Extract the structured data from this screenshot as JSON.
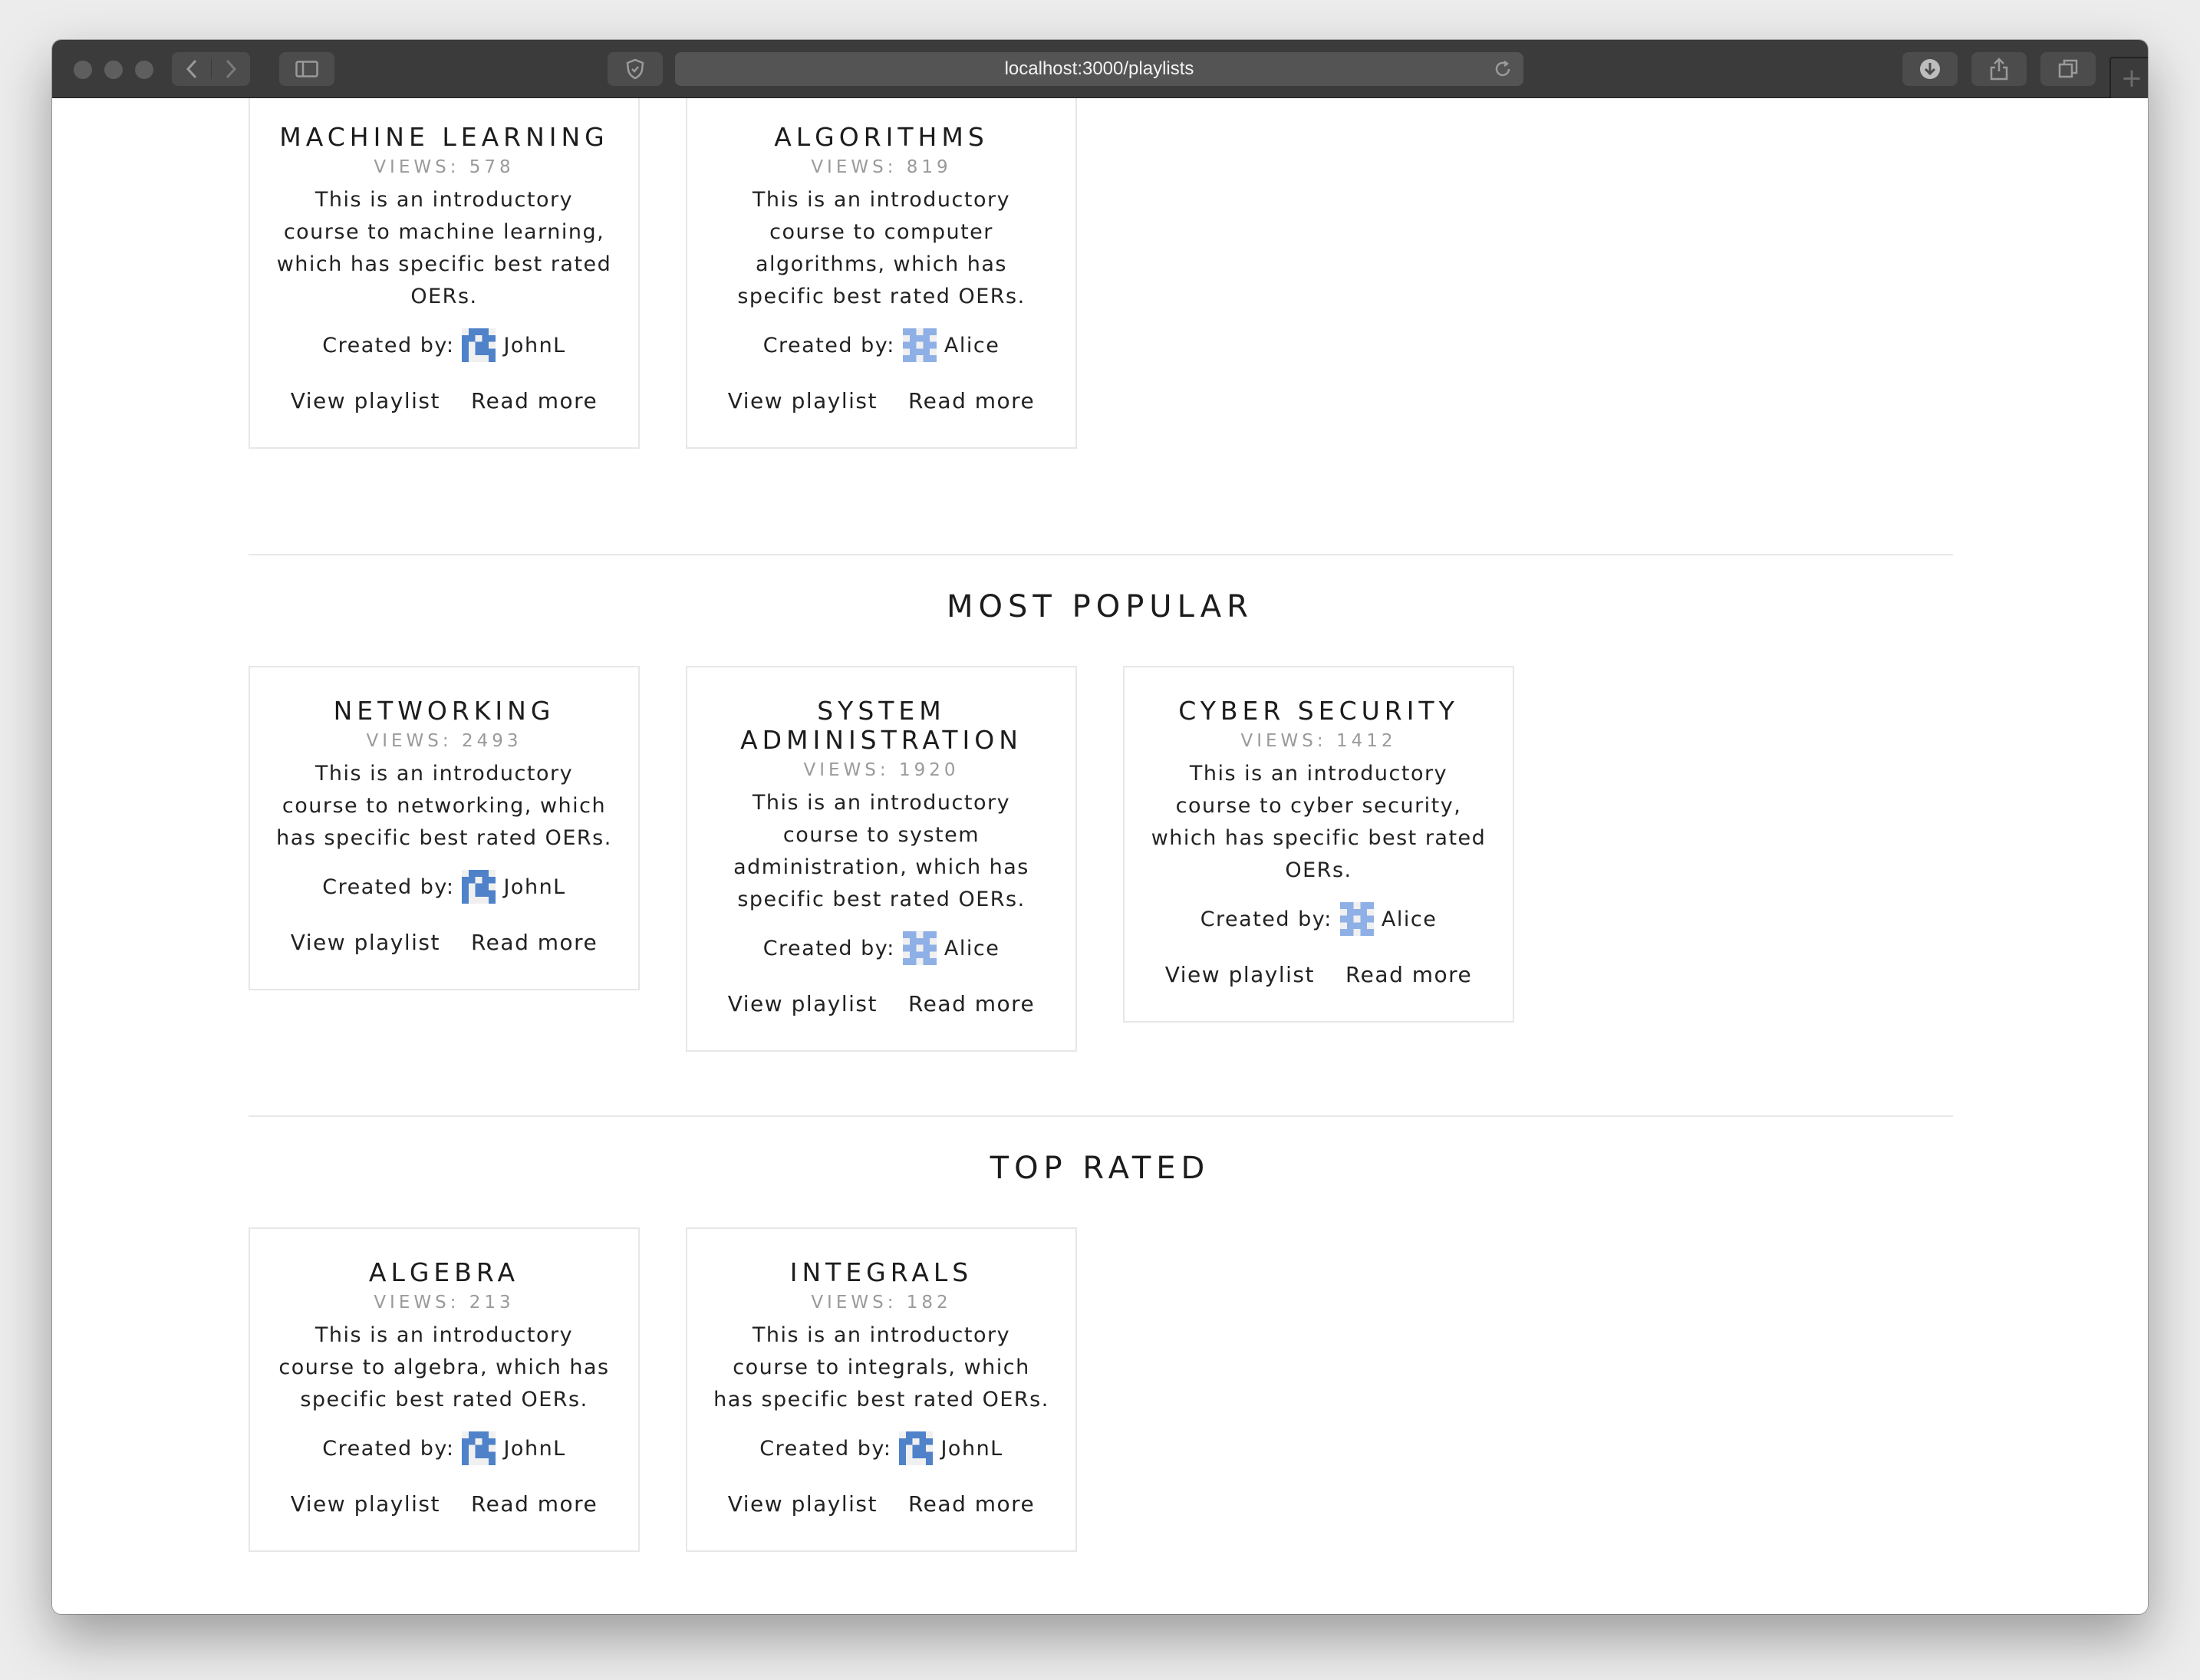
{
  "browser": {
    "url": "localhost:3000/playlists"
  },
  "sections": [
    {
      "title": "",
      "cards": [
        {
          "title": "MACHINE LEARNING",
          "views": "VIEWS: 578",
          "description": "This is an introductory course to machine learning, which has specific best rated OERs.",
          "created_by_label": "Created by:",
          "author": "JohnL",
          "view_label": "View playlist",
          "read_label": "Read more"
        },
        {
          "title": "ALGORITHMS",
          "views": "VIEWS: 819",
          "description": "This is an introductory course to computer algorithms, which has specific best rated OERs.",
          "created_by_label": "Created by:",
          "author": "Alice",
          "view_label": "View playlist",
          "read_label": "Read more"
        }
      ]
    },
    {
      "title": "MOST POPULAR",
      "cards": [
        {
          "title": "NETWORKING",
          "views": "VIEWS: 2493",
          "description": "This is an introductory course to networking, which has specific best rated OERs.",
          "created_by_label": "Created by:",
          "author": "JohnL",
          "view_label": "View playlist",
          "read_label": "Read more"
        },
        {
          "title": "SYSTEM ADMINISTRATION",
          "views": "VIEWS: 1920",
          "description": "This is an introductory course to system administration, which has specific best rated OERs.",
          "created_by_label": "Created by:",
          "author": "Alice",
          "view_label": "View playlist",
          "read_label": "Read more"
        },
        {
          "title": "CYBER SECURITY",
          "views": "VIEWS: 1412",
          "description": "This is an introductory course to cyber security, which has specific best rated OERs.",
          "created_by_label": "Created by:",
          "author": "Alice",
          "view_label": "View playlist",
          "read_label": "Read more"
        }
      ]
    },
    {
      "title": "TOP RATED",
      "cards": [
        {
          "title": "ALGEBRA",
          "views": "VIEWS: 213",
          "description": "This is an introductory course to algebra, which has specific best rated OERs.",
          "created_by_label": "Created by:",
          "author": "JohnL",
          "view_label": "View playlist",
          "read_label": "Read more"
        },
        {
          "title": "INTEGRALS",
          "views": "VIEWS: 182",
          "description": "This is an introductory course to integrals, which has specific best rated OERs.",
          "created_by_label": "Created by:",
          "author": "JohnL",
          "view_label": "View playlist",
          "read_label": "Read more"
        }
      ]
    }
  ],
  "colors": {
    "avatar_johnl": "#4f82c9",
    "avatar_alice": "#8fb0e6"
  }
}
